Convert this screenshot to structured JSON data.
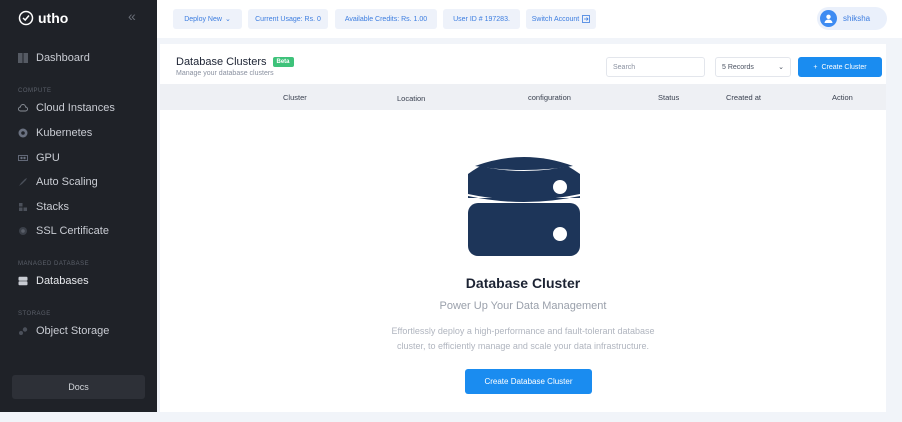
{
  "app": {
    "brand": "utho"
  },
  "sidebar": {
    "items": [
      {
        "label": "Dashboard",
        "icon": "grid-icon"
      },
      {
        "label": "Cloud Instances",
        "icon": "cloud-icon"
      },
      {
        "label": "Kubernetes",
        "icon": "kubernetes-icon"
      },
      {
        "label": "GPU",
        "icon": "gpu-icon"
      },
      {
        "label": "Auto Scaling",
        "icon": "rocket-icon"
      },
      {
        "label": "Stacks",
        "icon": "stack-icon"
      },
      {
        "label": "SSL Certificate",
        "icon": "certificate-icon"
      },
      {
        "label": "Databases",
        "icon": "database-icon"
      },
      {
        "label": "Object Storage",
        "icon": "storage-icon"
      }
    ],
    "sections": [
      "COMPUTE",
      "MANAGED DATABASE",
      "STORAGE"
    ],
    "docs_label": "Docs"
  },
  "topbar": {
    "deploy_label": "Deploy New",
    "usage_label": "Current Usage: Rs. 0",
    "credits_label": "Available Credits: Rs. 1.00",
    "userid_label": "User ID # 197283.",
    "switch_label": "Switch Account",
    "username": "shiksha"
  },
  "page": {
    "title": "Database Clusters",
    "badge": "Beta",
    "subtitle": "Manage your database clusters",
    "search_placeholder": "Search",
    "records_label": "5 Records",
    "create_label": "Create Cluster",
    "columns": [
      "Cluster",
      "Location",
      "configuration",
      "Status",
      "Created at",
      "Action"
    ]
  },
  "empty_state": {
    "title": "Database Cluster",
    "subtitle": "Power Up Your Data Management",
    "description_line1": "Effortlessly deploy a high-performance and fault-tolerant database",
    "description_line2": "cluster, to efficiently manage and scale your data infrastructure.",
    "button_label": "Create Database Cluster"
  },
  "colors": {
    "sidebar": "#1f2228",
    "accent": "#1a8cf0",
    "icon_navy": "#1d3559",
    "beta": "#3ec27a"
  }
}
